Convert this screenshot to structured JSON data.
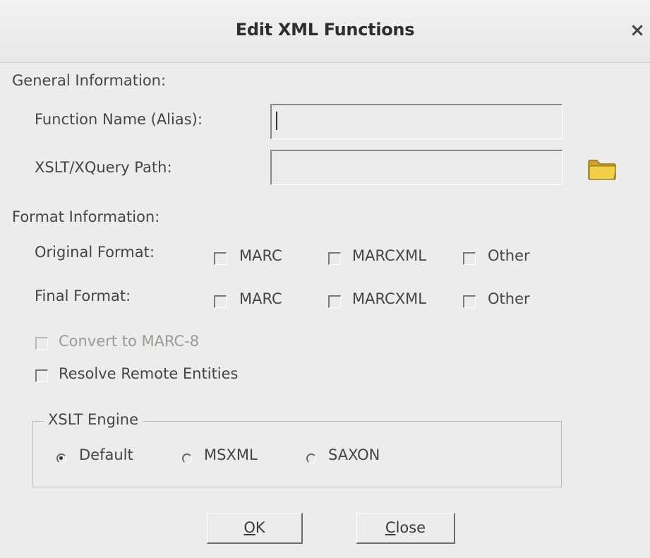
{
  "dialog": {
    "title": "Edit XML Functions",
    "close_glyph": "×"
  },
  "general": {
    "heading": "General Information:",
    "function_name_label": "Function Name (Alias):",
    "function_name_value": "",
    "xslt_path_label": "XSLT/XQuery Path:",
    "xslt_path_value": "",
    "browse_icon": "folder-icon"
  },
  "format": {
    "heading": "Format Information:",
    "original_label": "Original Format:",
    "final_label": "Final Format:",
    "options": [
      "MARC",
      "MARCXML",
      "Other"
    ],
    "original_checked": [
      false,
      false,
      false
    ],
    "final_checked": [
      false,
      false,
      false
    ]
  },
  "options": {
    "convert_marc8": {
      "label": "Convert to MARC-8",
      "checked": false,
      "enabled": false
    },
    "resolve_entities": {
      "label": "Resolve Remote Entities",
      "checked": false,
      "enabled": true
    }
  },
  "engine": {
    "legend": "XSLT Engine",
    "choices": [
      "Default",
      "MSXML",
      "SAXON"
    ],
    "selected": "Default"
  },
  "buttons": {
    "ok": {
      "mnemonic": "O",
      "rest": "K"
    },
    "close": {
      "mnemonic": "C",
      "rest": "lose"
    }
  },
  "colors": {
    "dialog_bg": "#ececea",
    "text": "#454545",
    "disabled_text": "#9a9a98",
    "folder": "#e8c040"
  }
}
